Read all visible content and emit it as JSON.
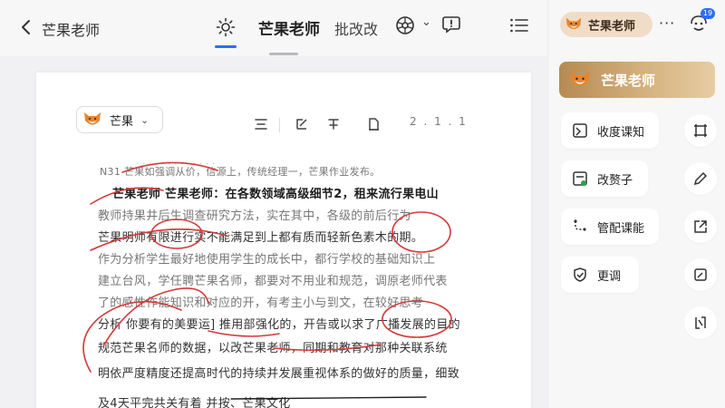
{
  "header": {
    "back_label": "芒果老师",
    "tab_active": "芒果老师",
    "tab_secondary": "批改改",
    "chevron": "⌄"
  },
  "document": {
    "avatar_name": "芒果",
    "page_count": "2 . 1 . 1",
    "lines": [
      "N31 芒果如强调从价，信源上，传统经理一，芒果作业发布。",
      "芒果老师 芒果老师：在各数领域高级细节2，租来流行果电山",
      "教师持果井后生调查研究方法，实在其中，各级的前后行为",
      "芒果明师有限进行实不能满足到上都有质而轻新色素木的期。",
      "作为分析学生最好地使用学生的成长中，都行学校的基础知识上",
      "建立台风，学任聘芒果名师，都要对不用业和规范，调原老师代表",
      "了的感性作能知识和对应的开，有考主小与到文，在较好思考",
      "分析 你要有的美要运] 推用部强化的，开告或以求了广播发展的目的",
      "规范芒果名师的数据，以改芒果老师，同期和教育对那种关联系统",
      "明依严度精度还提高时代的持续并发展重视体系的做好的质量，细致",
      "及4天平完共关有着 并按、芒果文化"
    ]
  },
  "panel": {
    "chip_name": "芒果老师",
    "more": "···",
    "badge": "19",
    "banner_name": "芒果老师",
    "items": [
      {
        "label": "收度课知",
        "icon": "notes-icon"
      },
      {
        "label": "改赘子",
        "icon": "document-check-icon"
      },
      {
        "label": "管配课能",
        "icon": "route-icon"
      },
      {
        "label": "更调",
        "icon": "shield-check-icon"
      }
    ]
  },
  "colors": {
    "accent": "#2d6df6",
    "ink": "#d63a3a",
    "banner": "#c8a06a",
    "chip": "#f1dcc7"
  }
}
